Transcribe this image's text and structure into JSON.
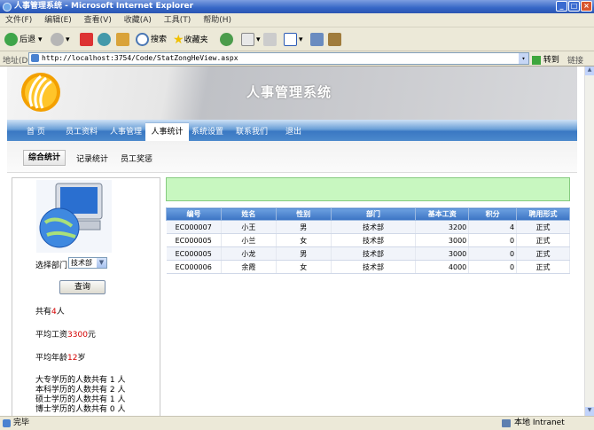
{
  "window": {
    "title": "人事管理系统 - Microsoft Internet Explorer"
  },
  "menu": [
    "文件(F)",
    "编辑(E)",
    "查看(V)",
    "收藏(A)",
    "工具(T)",
    "帮助(H)"
  ],
  "toolbar": {
    "back": "后退",
    "search": "搜索",
    "favorites": "收藏夹"
  },
  "address": {
    "label": "地址(D)",
    "url": "http://localhost:3754/Code/StatZongHeView.aspx",
    "go": "转到",
    "links": "链接"
  },
  "site": {
    "title": "人事管理系统"
  },
  "nav": {
    "items": [
      "首 页",
      "员工资料",
      "人事管理",
      "人事统计",
      "系统设置",
      "联系我们",
      "退出"
    ]
  },
  "subnav": {
    "items": [
      "综合统计",
      "记录统计",
      "员工奖惩"
    ]
  },
  "filter": {
    "label": "选择部门",
    "selected": "技术部",
    "button": "查询"
  },
  "stats": {
    "total_prefix": "共有",
    "total": "4",
    "total_suffix": "人",
    "salary_prefix": "平均工资",
    "salary": "3300",
    "salary_suffix": "元",
    "age_prefix": "平均年龄",
    "age": "12",
    "age_suffix": "岁",
    "edu": [
      "大专学历的人数共有 1 人",
      "本科学历的人数共有 2 人",
      "硕士学历的人数共有 1 人",
      "博士学历的人数共有 0 人"
    ]
  },
  "table": {
    "headers": [
      "编号",
      "姓名",
      "性别",
      "部门",
      "基本工资",
      "积分",
      "聘用形式"
    ],
    "rows": [
      [
        "EC000007",
        "小王",
        "男",
        "技术部",
        "3200",
        "4",
        "正式"
      ],
      [
        "EC000005",
        "小兰",
        "女",
        "技术部",
        "3000",
        "0",
        "正式"
      ],
      [
        "EC000005",
        "小龙",
        "男",
        "技术部",
        "3000",
        "0",
        "正式"
      ],
      [
        "EC000006",
        "余霞",
        "女",
        "技术部",
        "4000",
        "0",
        "正式"
      ]
    ]
  },
  "status": {
    "left": "完毕",
    "zone": "本地 Intranet"
  }
}
